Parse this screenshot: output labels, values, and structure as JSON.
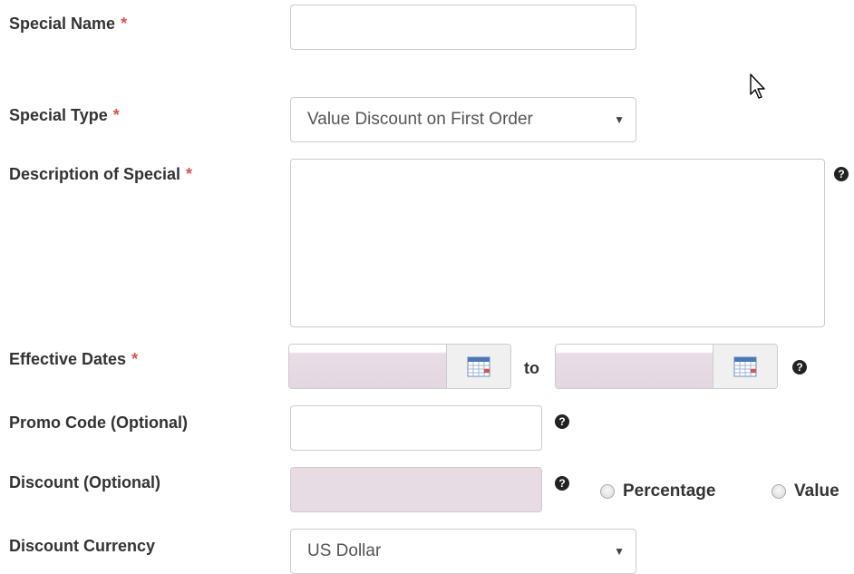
{
  "form": {
    "special_name": {
      "label": "Special Name",
      "required_mark": "*",
      "value": ""
    },
    "special_type": {
      "label": "Special Type",
      "required_mark": "*",
      "selected": "Value Discount on First Order",
      "caret": "▼"
    },
    "description": {
      "label": "Description of Special",
      "required_mark": "*",
      "value": "",
      "help_glyph": "?"
    },
    "effective_dates": {
      "label": "Effective Dates",
      "required_mark": "*",
      "separator": "to",
      "start_value": "",
      "end_value": "",
      "help_glyph": "?"
    },
    "promo_code": {
      "label": "Promo Code (Optional)",
      "value": "",
      "help_glyph": "?"
    },
    "discount": {
      "label": "Discount (Optional)",
      "value": "",
      "help_glyph": "?",
      "option_percentage": "Percentage",
      "option_value": "Value"
    },
    "discount_currency": {
      "label": "Discount Currency",
      "selected": "US Dollar",
      "caret": "▼"
    }
  },
  "icons": {
    "help": "question-circle-icon",
    "calendar": "calendar-icon",
    "cursor": "mouse-pointer-icon"
  },
  "colors": {
    "required": "#d9534f",
    "disabled_field": "#e7dce4",
    "border": "#cccccc",
    "label_text": "#333333"
  }
}
